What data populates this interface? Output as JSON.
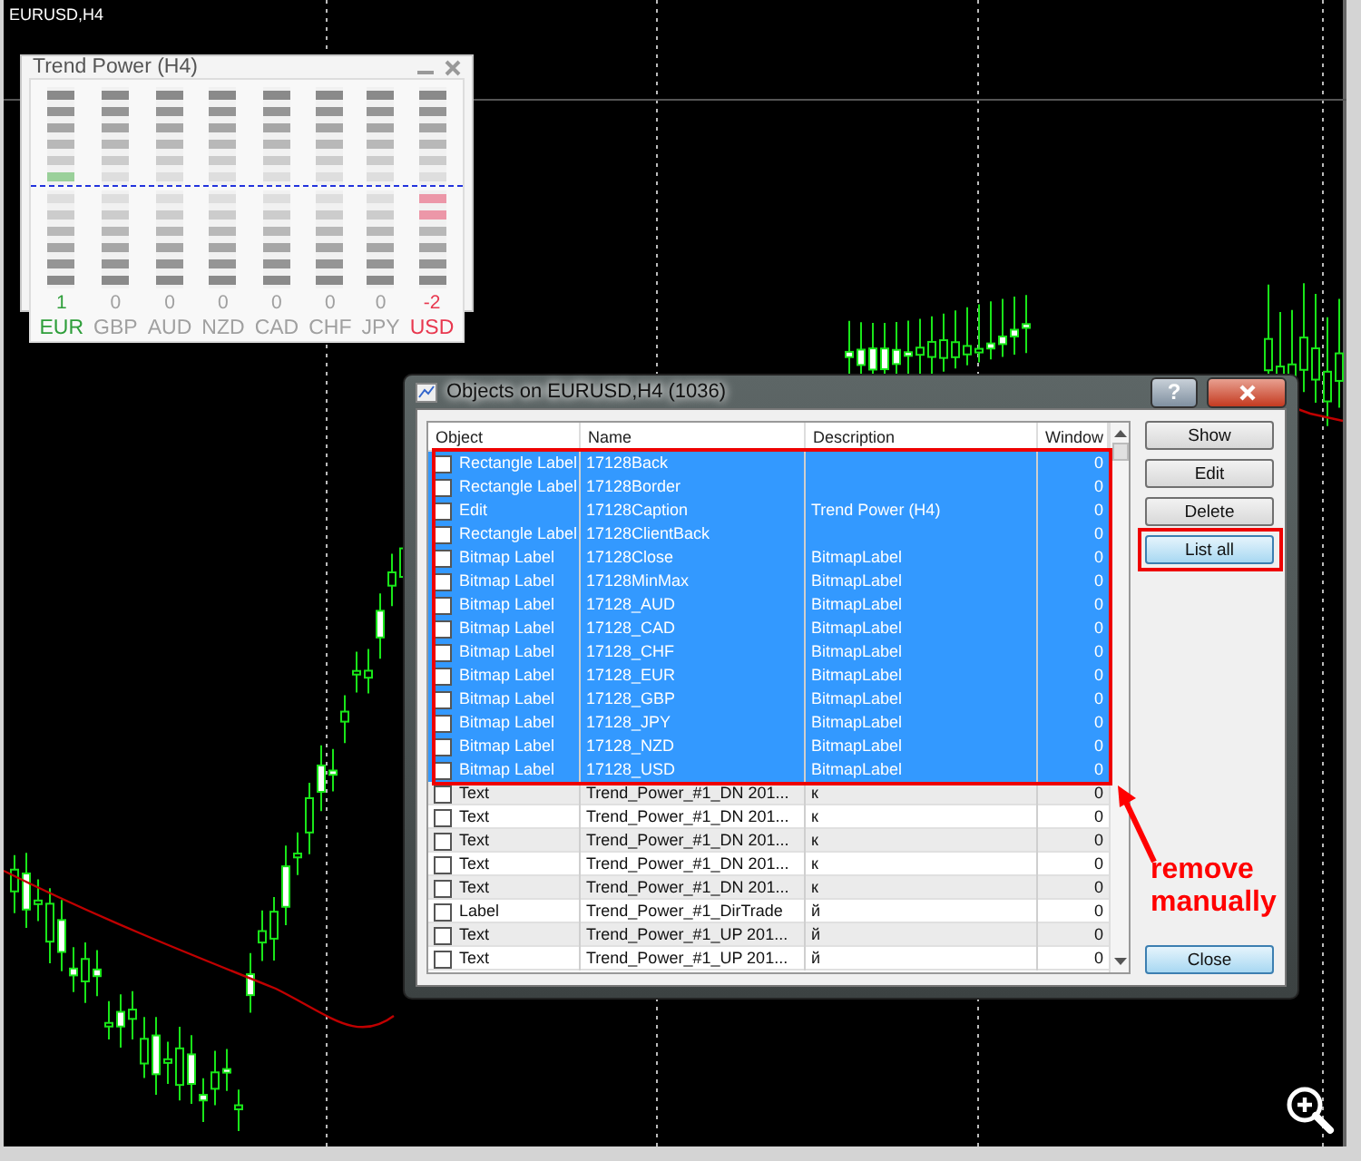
{
  "chart": {
    "symbol": "EURUSD,H4"
  },
  "indicator_panel": {
    "title": "Trend Power (H4)",
    "currencies": [
      {
        "value": "1",
        "label": "EUR",
        "color": "#2e9e3a",
        "kind": "up",
        "level": 0.1667
      },
      {
        "value": "0",
        "label": "GBP",
        "color": "#a0a0a0",
        "kind": "flat"
      },
      {
        "value": "0",
        "label": "AUD",
        "color": "#a0a0a0",
        "kind": "flat"
      },
      {
        "value": "0",
        "label": "NZD",
        "color": "#a0a0a0",
        "kind": "flat"
      },
      {
        "value": "0",
        "label": "CAD",
        "color": "#a0a0a0",
        "kind": "flat"
      },
      {
        "value": "0",
        "label": "CHF",
        "color": "#a0a0a0",
        "kind": "flat"
      },
      {
        "value": "0",
        "label": "JPY",
        "color": "#a0a0a0",
        "kind": "flat"
      },
      {
        "value": "-2",
        "label": "USD",
        "color": "#e8384f",
        "kind": "down",
        "level": 0.3333
      }
    ]
  },
  "dialog": {
    "title": "Objects on EURUSD,H4 (1036)",
    "help_button": "?",
    "columns": [
      "Object",
      "Name",
      "Description",
      "Window"
    ],
    "rows": [
      {
        "checked": false,
        "selected": true,
        "object": "Rectangle Label",
        "name": "17128Back",
        "window": "0"
      },
      {
        "checked": false,
        "selected": true,
        "object": "Rectangle Label",
        "name": "17128Border",
        "window": "0"
      },
      {
        "checked": false,
        "selected": true,
        "object": "Edit",
        "name": "17128Caption",
        "description": "Trend Power (H4)",
        "window": "0"
      },
      {
        "checked": false,
        "selected": true,
        "object": "Rectangle Label",
        "name": "17128ClientBack",
        "window": "0"
      },
      {
        "checked": false,
        "selected": true,
        "object": "Bitmap Label",
        "name": "17128Close",
        "description": "BitmapLabel",
        "window": "0"
      },
      {
        "checked": false,
        "selected": true,
        "object": "Bitmap Label",
        "name": "17128MinMax",
        "description": "BitmapLabel",
        "window": "0"
      },
      {
        "checked": false,
        "selected": true,
        "object": "Bitmap Label",
        "name": "17128_AUD",
        "description": "BitmapLabel",
        "window": "0"
      },
      {
        "checked": false,
        "selected": true,
        "object": "Bitmap Label",
        "name": "17128_CAD",
        "description": "BitmapLabel",
        "window": "0"
      },
      {
        "checked": false,
        "selected": true,
        "object": "Bitmap Label",
        "name": "17128_CHF",
        "description": "BitmapLabel",
        "window": "0"
      },
      {
        "checked": false,
        "selected": true,
        "object": "Bitmap Label",
        "name": "17128_EUR",
        "description": "BitmapLabel",
        "window": "0"
      },
      {
        "checked": false,
        "selected": true,
        "object": "Bitmap Label",
        "name": "17128_GBP",
        "description": "BitmapLabel",
        "window": "0"
      },
      {
        "checked": false,
        "selected": true,
        "object": "Bitmap Label",
        "name": "17128_JPY",
        "description": "BitmapLabel",
        "window": "0"
      },
      {
        "checked": false,
        "selected": true,
        "object": "Bitmap Label",
        "name": "17128_NZD",
        "description": "BitmapLabel",
        "window": "0"
      },
      {
        "checked": false,
        "selected": true,
        "object": "Bitmap Label",
        "name": "17128_USD",
        "description": "BitmapLabel",
        "window": "0"
      },
      {
        "checked": false,
        "selected": false,
        "object": "Text",
        "name": "Trend_Power_#1_DN 201...",
        "description": "к",
        "window": "0"
      },
      {
        "checked": false,
        "selected": false,
        "object": "Text",
        "name": "Trend_Power_#1_DN 201...",
        "description": "к",
        "window": "0"
      },
      {
        "checked": false,
        "selected": false,
        "object": "Text",
        "name": "Trend_Power_#1_DN 201...",
        "description": "к",
        "window": "0"
      },
      {
        "checked": false,
        "selected": false,
        "object": "Text",
        "name": "Trend_Power_#1_DN 201...",
        "description": "к",
        "window": "0"
      },
      {
        "checked": false,
        "selected": false,
        "object": "Text",
        "name": "Trend_Power_#1_DN 201...",
        "description": "к",
        "window": "0"
      },
      {
        "checked": false,
        "selected": false,
        "object": "Label",
        "name": "Trend_Power_#1_DirTrade",
        "description": "й",
        "window": "0"
      },
      {
        "checked": false,
        "selected": false,
        "object": "Text",
        "name": "Trend_Power_#1_UP 201...",
        "description": "й",
        "window": "0"
      },
      {
        "checked": false,
        "selected": false,
        "object": "Text",
        "name": "Trend_Power_#1_UP 201...",
        "description": "й",
        "window": "0"
      }
    ],
    "buttons": [
      {
        "label": "Show",
        "kind": "action",
        "selected": false
      },
      {
        "label": "Edit",
        "kind": "action",
        "selected": false
      },
      {
        "label": "Delete",
        "kind": "action",
        "selected": false
      },
      {
        "label": "List all",
        "kind": "action",
        "selected": true
      },
      {
        "label": "Close",
        "kind": "close",
        "selected": true
      }
    ]
  },
  "annotation": {
    "text": "remove manually"
  }
}
